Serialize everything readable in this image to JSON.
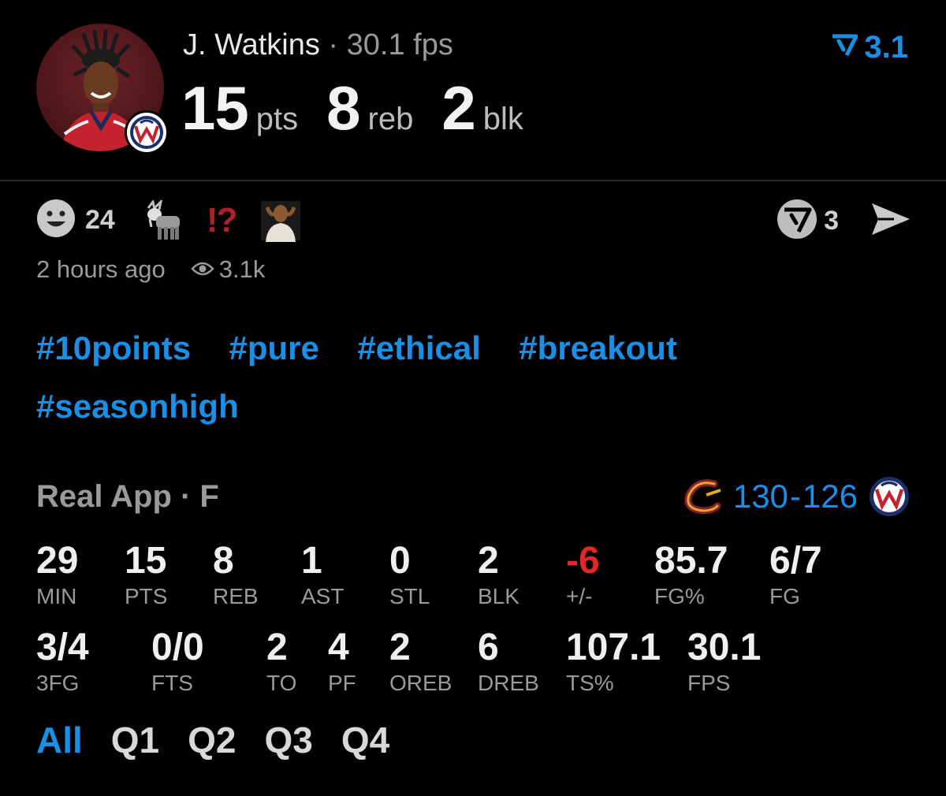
{
  "header": {
    "player_name": "J. Watkins",
    "separator": "·",
    "fps_text": "30.1 fps",
    "big_stats": [
      {
        "value": "15",
        "unit": "pts"
      },
      {
        "value": "8",
        "unit": "reb"
      },
      {
        "value": "2",
        "unit": "blk"
      }
    ],
    "rating": "3.1",
    "rating_icon": "real-rating-icon",
    "avatar_icon": "player-avatar",
    "team_icon": "wizards-logo-icon"
  },
  "reactions": {
    "smile_icon": "smile-icon",
    "smile_count": "24",
    "goat_icon": "goat-emoji",
    "interrobang": "!?",
    "shocked_icon": "shocked-person-emoji"
  },
  "actions": {
    "comment_icon": "real-logo-icon",
    "comment_count": "3",
    "share_icon": "send-icon"
  },
  "meta": {
    "time_ago": "2 hours ago",
    "views": "3.1k",
    "eye_icon": "eye-icon"
  },
  "tags": [
    "#10points",
    "#pure",
    "#ethical",
    "#breakout",
    "#seasonhigh"
  ],
  "game": {
    "title": "Real App · F",
    "home_score": "130",
    "dash": "-",
    "away_score": "126",
    "left_logo": "cavaliers-logo-icon",
    "right_logo": "wizards-logo-icon"
  },
  "stats_row1": [
    {
      "value": "29",
      "label": "MIN"
    },
    {
      "value": "15",
      "label": "PTS"
    },
    {
      "value": "8",
      "label": "REB"
    },
    {
      "value": "1",
      "label": "AST"
    },
    {
      "value": "0",
      "label": "STL"
    },
    {
      "value": "2",
      "label": "BLK"
    },
    {
      "value": "-6",
      "label": "+/-"
    },
    {
      "value": "85.7",
      "label": "FG%"
    },
    {
      "value": "6/7",
      "label": "FG"
    }
  ],
  "stats_row2": [
    {
      "value": "3/4",
      "label": "3FG"
    },
    {
      "value": "0/0",
      "label": "FTS"
    },
    {
      "value": "2",
      "label": "TO"
    },
    {
      "value": "4",
      "label": "PF"
    },
    {
      "value": "2",
      "label": "OREB"
    },
    {
      "value": "6",
      "label": "DREB"
    },
    {
      "value": "107.1",
      "label": "TS%"
    },
    {
      "value": "30.1",
      "label": "FPS"
    }
  ],
  "quarter_tabs": [
    "All",
    "Q1",
    "Q2",
    "Q3",
    "Q4"
  ],
  "colors": {
    "accent": "#1a8fe6",
    "negative": "#e02828",
    "muted": "#9a9a9a",
    "background": "#000000"
  }
}
